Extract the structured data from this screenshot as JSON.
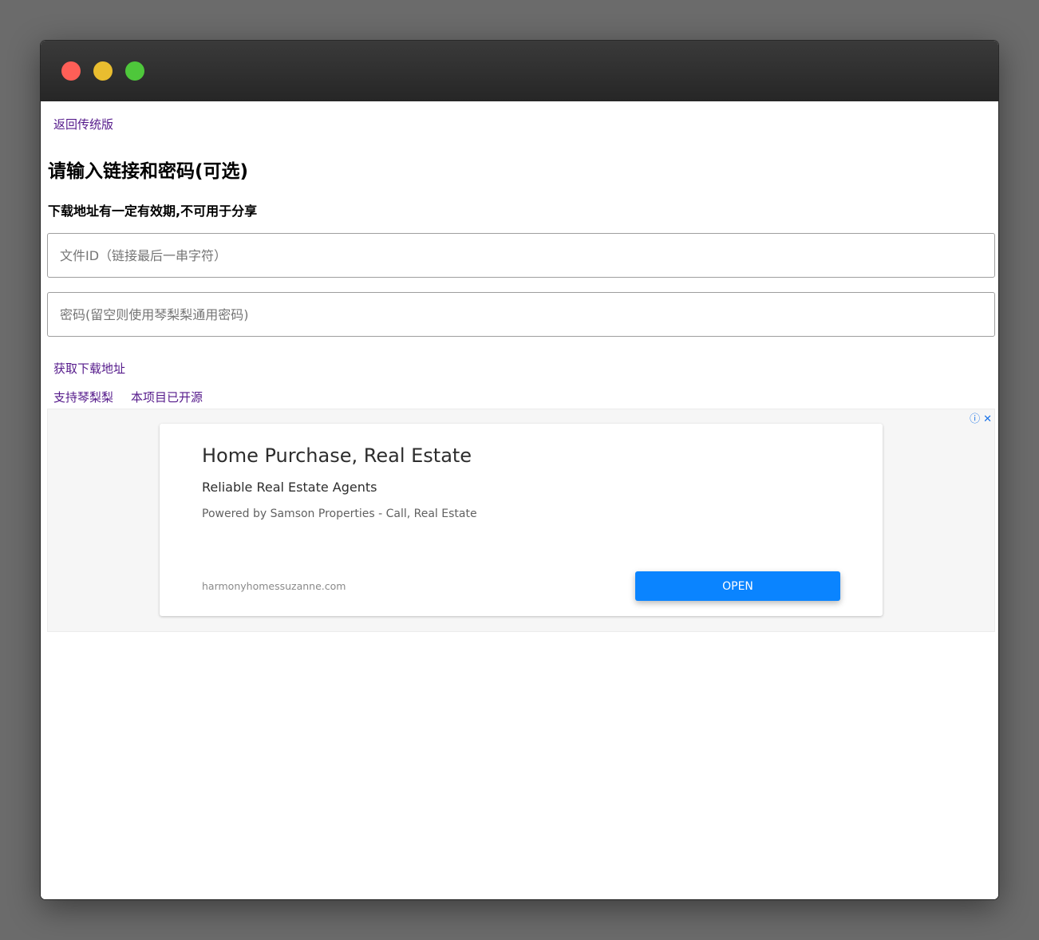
{
  "window": {
    "controls": [
      "close",
      "minimize",
      "maximize"
    ]
  },
  "page": {
    "back_link": "返回传统版",
    "title": "请输入链接和密码(可选)",
    "subtitle": "下载地址有一定有效期,不可用于分享",
    "file_id_placeholder": "文件ID（链接最后一串字符）",
    "file_id_value": "",
    "password_placeholder": "密码(留空则使用琴梨梨通用密码)",
    "password_value": "",
    "get_link": "获取下载地址",
    "support_link": "支持琴梨梨",
    "opensource_link": "本项目已开源"
  },
  "ad": {
    "headline": "Home Purchase, Real Estate",
    "subline": "Reliable Real Estate Agents",
    "body": "Powered by Samson Properties - Call, Real Estate",
    "domain": "harmonyhomessuzanne.com",
    "cta": "OPEN",
    "info_icon": "ⓘ",
    "close_icon": "✕",
    "cta_color": "#0a84ff"
  },
  "colors": {
    "link": "#551a8b",
    "titlebar": "#2f2f2f",
    "close": "#fe5f57",
    "minimize": "#e9bd2f",
    "maximize": "#4ec73b"
  }
}
